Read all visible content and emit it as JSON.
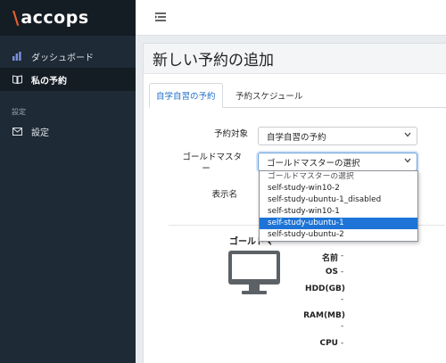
{
  "brand": {
    "mark": "\\",
    "name": "accops",
    "accent": "#e8612c"
  },
  "sidebar": {
    "items": [
      {
        "label": "ダッシュボード",
        "icon": "bar-chart-icon"
      },
      {
        "label": "私の予約",
        "icon": "book-icon",
        "active": true
      }
    ],
    "section_title": "設定",
    "settings_item": {
      "label": "設定",
      "icon": "mail-icon"
    }
  },
  "topbar": {
    "menu_icon": "menu-toggle-icon"
  },
  "page": {
    "title": "新しい予約の追加"
  },
  "tabs": [
    {
      "label": "自学自習の予約",
      "active": true
    },
    {
      "label": "予約スケジュール",
      "active": false
    }
  ],
  "form": {
    "target_label": "予約対象",
    "target_value": "自学自習の予約",
    "golden_master_label_line1": "ゴールドマスタ",
    "golden_master_label_line2": "ー",
    "golden_master_value": "ゴールドマスターの選択",
    "display_name_label": "表示名"
  },
  "dropdown": {
    "options": [
      "ゴールドマスターの選択",
      "self-study-win10-2",
      "self-study-ubuntu-1_disabled",
      "self-study-win10-1",
      "self-study-ubuntu-1",
      "self-study-ubuntu-2"
    ],
    "selected_index": 4,
    "highlight_color": "#1e74d6"
  },
  "details": {
    "heading": "ゴールドマ",
    "specs": [
      {
        "label": "名前",
        "value": "-"
      },
      {
        "label": "OS",
        "value": "-"
      },
      {
        "label": "HDD(GB)",
        "value": "-"
      },
      {
        "label": "RAM(MB)",
        "value": "-"
      },
      {
        "label": "CPU",
        "value": "-"
      }
    ]
  }
}
